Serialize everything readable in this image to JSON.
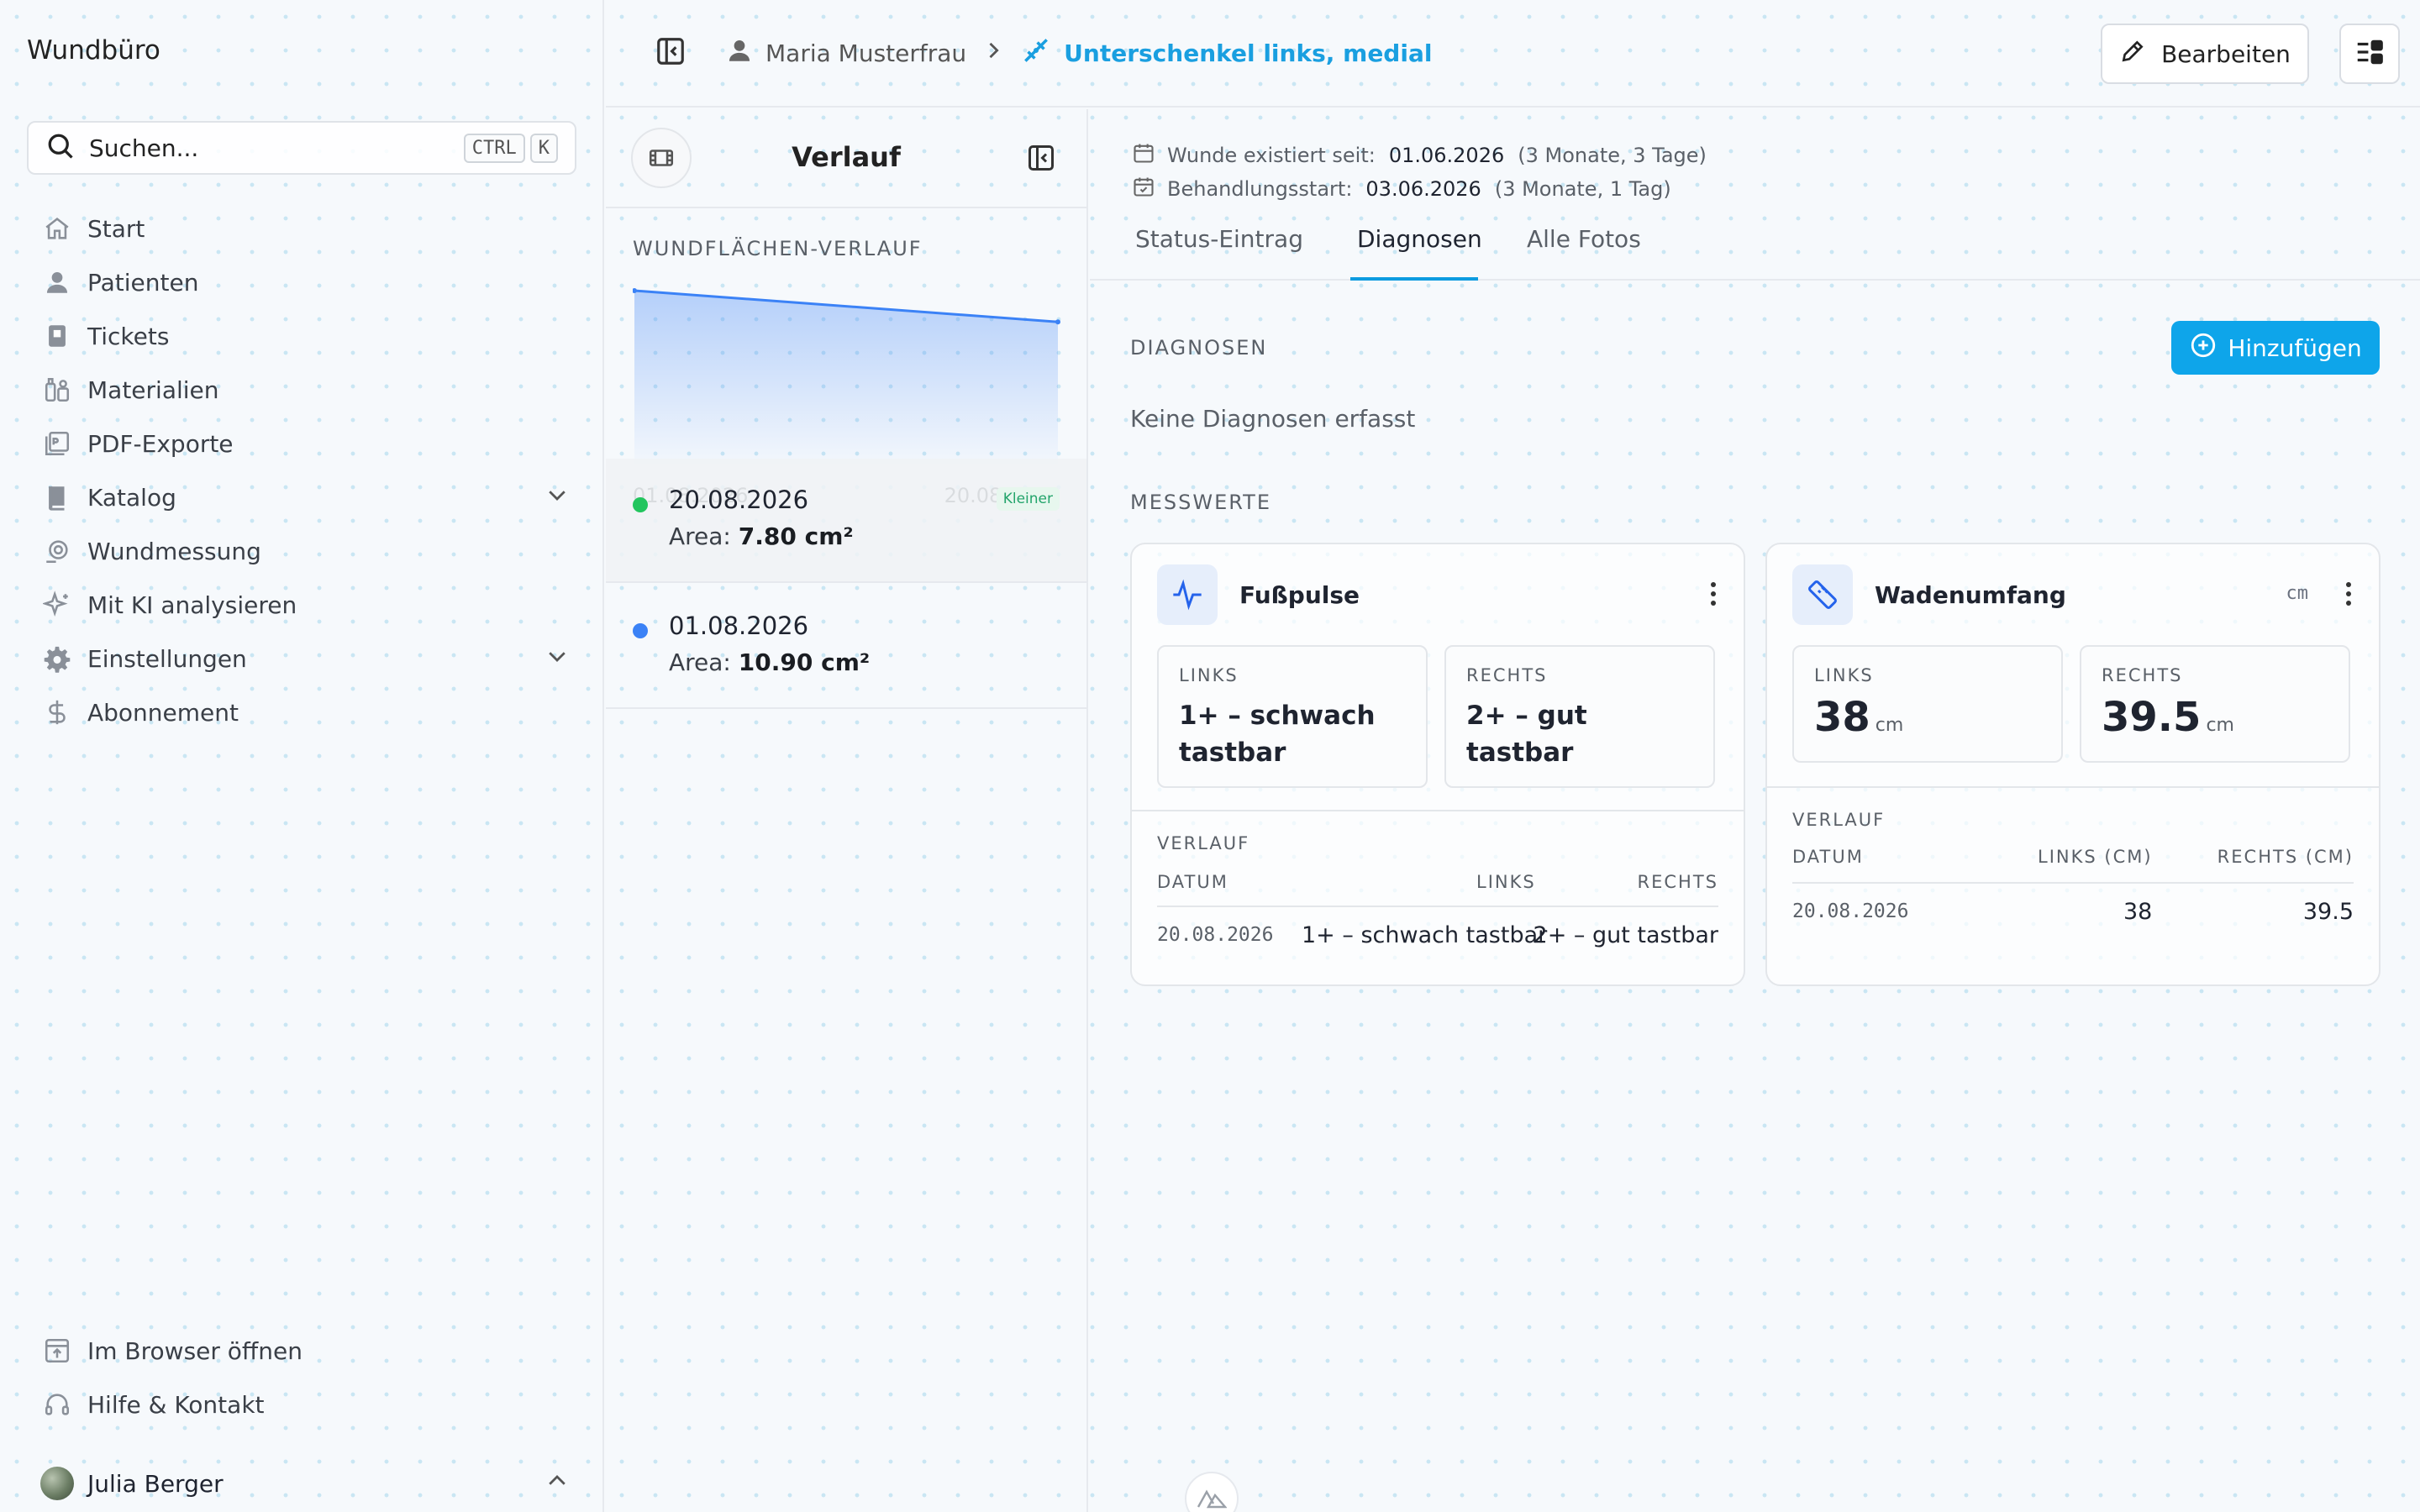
{
  "sidebar": {
    "app_title": "Wundbüro",
    "search": {
      "label": "Suchen...",
      "kbd1": "CTRL",
      "kbd2": "K"
    },
    "items": [
      {
        "label": "Start",
        "icon": "home-icon"
      },
      {
        "label": "Patienten",
        "icon": "user-icon"
      },
      {
        "label": "Tickets",
        "icon": "ticket-icon"
      },
      {
        "label": "Materialien",
        "icon": "materials-icon"
      },
      {
        "label": "PDF-Exporte",
        "icon": "pdf-icon"
      },
      {
        "label": "Katalog",
        "icon": "book-icon"
      },
      {
        "label": "Wundmessung",
        "icon": "measure-icon"
      },
      {
        "label": "Mit KI analysieren",
        "icon": "sparkle-icon"
      },
      {
        "label": "Einstellungen",
        "icon": "gear-icon"
      },
      {
        "label": "Abonnement",
        "icon": "dollar-icon"
      }
    ],
    "bottom_items": [
      {
        "label": "Im Browser öffnen",
        "icon": "browser-icon"
      },
      {
        "label": "Hilfe & Kontakt",
        "icon": "headset-icon"
      }
    ],
    "user_name": "Julia Berger"
  },
  "header": {
    "patient": "Maria Musterfrau",
    "wound": "Unterschenkel links, medial",
    "edit_label": "Bearbeiten"
  },
  "verlauf": {
    "title": "Verlauf",
    "chart_label": "WUNDFLÄCHEN-VERLAUF",
    "entries": [
      {
        "date": "20.08.2026",
        "area_label": "Area:",
        "area_value": "7.80 cm²",
        "badge": "Kleiner"
      },
      {
        "date": "01.08.2026",
        "area_label": "Area:",
        "area_value": "10.90 cm²"
      }
    ]
  },
  "chart_data": {
    "type": "area",
    "x": [
      "01.08.2026",
      "20.08.2026"
    ],
    "values": [
      10.9,
      7.8
    ],
    "title": "WUNDFLÄCHEN-VERLAUF",
    "xlabel": "",
    "ylabel": "",
    "grid": false,
    "color": "#3b82f6"
  },
  "main": {
    "meta": [
      {
        "label": "Wunde existiert seit:",
        "value": "01.06.2026",
        "relative": "(3 Monate, 3 Tage)"
      },
      {
        "label": "Behandlungsstart:",
        "value": "03.06.2026",
        "relative": "(3 Monate, 1 Tag)"
      }
    ],
    "tabs": [
      "Status-Eintrag",
      "Diagnosen",
      "Alle Fotos"
    ],
    "active_tab": "Diagnosen",
    "diagnoses_label": "DIAGNOSEN",
    "add_label": "Hinzufügen",
    "empty_text": "Keine Diagnosen erfasst",
    "measurements_label": "MESSWERTE",
    "cards": {
      "fusspulse": {
        "title": "Fußpulse",
        "left_label": "LINKS",
        "left_value": "1+ – schwach tastbar",
        "right_label": "RECHTS",
        "right_value": "2+ – gut tastbar",
        "history_label": "VERLAUF",
        "col_date": "DATUM",
        "col_left": "LINKS",
        "col_right": "RECHTS",
        "rows": [
          {
            "date": "20.08.2026",
            "left": "1+ – schwach tastbar",
            "right": "2+ – gut tastbar"
          }
        ]
      },
      "wadenumfang": {
        "title": "Wadenumfang",
        "unit": "cm",
        "left_label": "LINKS",
        "left_value": "38",
        "right_label": "RECHTS",
        "right_value": "39.5",
        "history_label": "VERLAUF",
        "col_date": "DATUM",
        "col_left": "LINKS (CM)",
        "col_right": "RECHTS (CM)",
        "rows": [
          {
            "date": "20.08.2026",
            "left": "38",
            "right": "39.5"
          }
        ]
      }
    }
  },
  "colors": {
    "accent": "#0ea5ea",
    "success": "#22c55e",
    "chart_line": "#3b82f6"
  }
}
